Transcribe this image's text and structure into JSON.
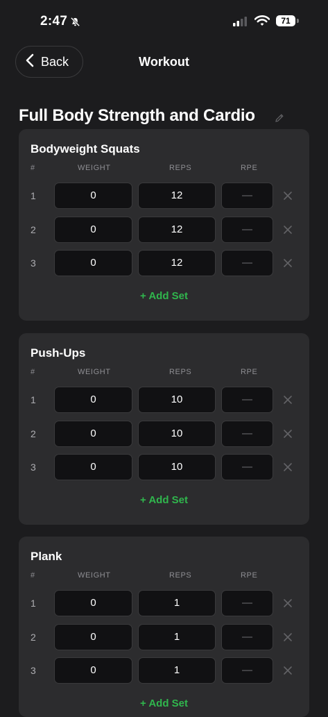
{
  "status": {
    "time": "2:47",
    "battery": "71"
  },
  "nav": {
    "back_label": "Back",
    "title": "Workout"
  },
  "workout_title": "Full Body Strength and Cardio",
  "columns": {
    "set": "#",
    "weight": "WEIGHT",
    "reps": "REPS",
    "rpe": "RPE"
  },
  "add_set_label": "+ Add Set",
  "exercises": [
    {
      "name": "Bodyweight Squats",
      "sets": [
        {
          "num": "1",
          "weight": "0",
          "reps": "12",
          "rpe": "—"
        },
        {
          "num": "2",
          "weight": "0",
          "reps": "12",
          "rpe": "—"
        },
        {
          "num": "3",
          "weight": "0",
          "reps": "12",
          "rpe": "—"
        }
      ]
    },
    {
      "name": "Push-Ups",
      "sets": [
        {
          "num": "1",
          "weight": "0",
          "reps": "10",
          "rpe": "—"
        },
        {
          "num": "2",
          "weight": "0",
          "reps": "10",
          "rpe": "—"
        },
        {
          "num": "3",
          "weight": "0",
          "reps": "10",
          "rpe": "—"
        }
      ]
    },
    {
      "name": "Plank",
      "sets": [
        {
          "num": "1",
          "weight": "0",
          "reps": "1",
          "rpe": "—"
        },
        {
          "num": "2",
          "weight": "0",
          "reps": "1",
          "rpe": "—"
        },
        {
          "num": "3",
          "weight": "0",
          "reps": "1",
          "rpe": "—"
        }
      ]
    }
  ],
  "colors": {
    "background": "#1c1c1e",
    "card": "#2c2c2e",
    "accent": "#30b64d"
  },
  "icons": {
    "back": "chevron-left-icon",
    "edit": "pencil-icon",
    "delete": "close-icon",
    "mute": "bell-slash-icon",
    "signal": "cellular-signal-icon",
    "wifi": "wifi-icon"
  }
}
